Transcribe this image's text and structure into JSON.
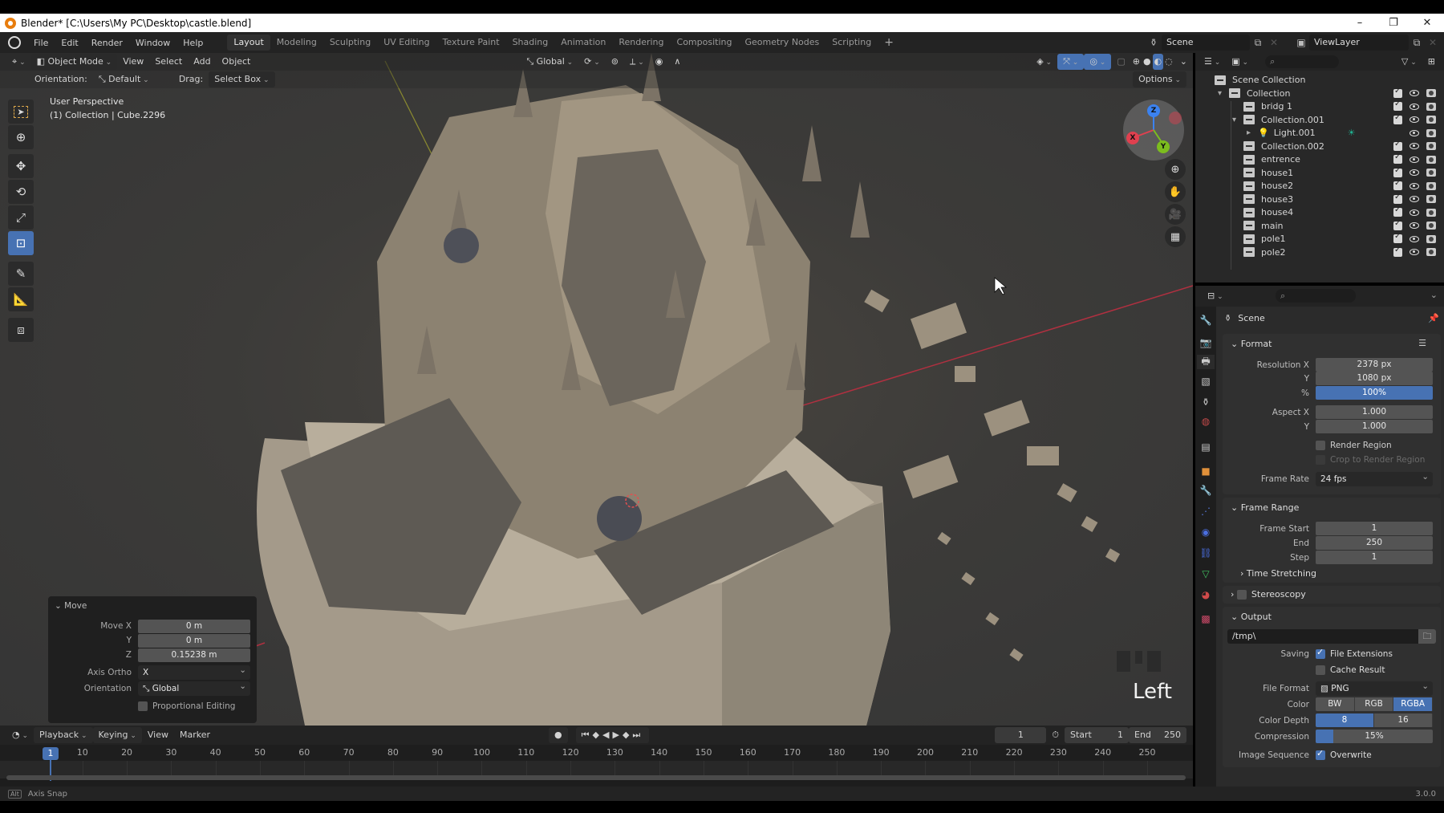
{
  "window": {
    "title": "Blender* [C:\\Users\\My PC\\Desktop\\castle.blend]",
    "controls": [
      "–",
      "❐",
      "✕"
    ]
  },
  "menubar": {
    "menus": [
      "File",
      "Edit",
      "Render",
      "Window",
      "Help"
    ],
    "workspaces": [
      "Layout",
      "Modeling",
      "Sculpting",
      "UV Editing",
      "Texture Paint",
      "Shading",
      "Animation",
      "Rendering",
      "Compositing",
      "Geometry Nodes",
      "Scripting"
    ],
    "active_workspace": "Layout",
    "add_workspace": "+",
    "scene": "Scene",
    "view_layer": "ViewLayer"
  },
  "viewport": {
    "header": {
      "mode": "Object Mode",
      "menus": [
        "View",
        "Select",
        "Add",
        "Object"
      ],
      "transform_orientation": "Global",
      "options_label": "Options"
    },
    "tool_settings": {
      "orientation_label": "Orientation:",
      "orientation_value": "Default",
      "drag_label": "Drag:",
      "drag_value": "Select Box"
    },
    "info_line1": "User Perspective",
    "info_line2": "(1) Collection | Cube.2296",
    "tools": [
      "select-box",
      "cursor",
      "move",
      "rotate",
      "scale",
      "transform",
      "annotate",
      "measure",
      "add-cube"
    ],
    "active_tool": "transform",
    "gizmo_axes": [
      "X",
      "Y",
      "Z"
    ],
    "overlay_text": "Left"
  },
  "move_panel": {
    "title": "Move",
    "rows": [
      {
        "label": "Move X",
        "value": "0 m"
      },
      {
        "label": "Y",
        "value": "0 m"
      },
      {
        "label": "Z",
        "value": "0.15238 m"
      }
    ],
    "axis_ortho_label": "Axis Ortho",
    "axis_ortho_value": "X",
    "orientation_label": "Orientation",
    "orientation_value": "Global",
    "proportional_label": "Proportional Editing",
    "proportional_checked": false
  },
  "timeline": {
    "menus": [
      "Playback",
      "Keying",
      "View",
      "Marker"
    ],
    "current_frame": "1",
    "start_label": "Start",
    "start": "1",
    "end_label": "End",
    "end": "250",
    "ticks": [
      "10",
      "20",
      "30",
      "40",
      "50",
      "60",
      "70",
      "80",
      "90",
      "100",
      "110",
      "120",
      "130",
      "140",
      "150",
      "160",
      "170",
      "180",
      "190",
      "200",
      "210",
      "220",
      "230",
      "240",
      "250"
    ],
    "playhead": "1"
  },
  "statusbar": {
    "hint_key": "Alt",
    "hint": "Axis Snap",
    "version": "3.0.0"
  },
  "outliner": {
    "root": "Scene Collection",
    "items": [
      {
        "name": "Collection",
        "depth": 0,
        "expanded": true,
        "type": "collection"
      },
      {
        "name": "bridg 1",
        "depth": 1,
        "type": "collection"
      },
      {
        "name": "Collection.001",
        "depth": 1,
        "expanded": true,
        "type": "collection"
      },
      {
        "name": "Light.001",
        "depth": 2,
        "type": "light"
      },
      {
        "name": "Collection.002",
        "depth": 1,
        "type": "collection"
      },
      {
        "name": "entrence",
        "depth": 1,
        "type": "collection"
      },
      {
        "name": "house1",
        "depth": 1,
        "type": "collection"
      },
      {
        "name": "house2",
        "depth": 1,
        "type": "collection"
      },
      {
        "name": "house3",
        "depth": 1,
        "type": "collection"
      },
      {
        "name": "house4",
        "depth": 1,
        "type": "collection"
      },
      {
        "name": "main",
        "depth": 1,
        "type": "collection"
      },
      {
        "name": "pole1",
        "depth": 1,
        "type": "collection"
      },
      {
        "name": "pole2",
        "depth": 1,
        "type": "collection"
      }
    ]
  },
  "properties": {
    "context": "Scene",
    "format": {
      "title": "Format",
      "resolution_x_label": "Resolution X",
      "resolution_x": "2378 px",
      "resolution_y_label": "Y",
      "resolution_y": "1080 px",
      "percent_label": "%",
      "percent": "100%",
      "aspect_x_label": "Aspect X",
      "aspect_x": "1.000",
      "aspect_y_label": "Y",
      "aspect_y": "1.000",
      "render_region": "Render Region",
      "crop_region": "Crop to Render Region",
      "frame_rate_label": "Frame Rate",
      "frame_rate": "24 fps"
    },
    "frame_range": {
      "title": "Frame Range",
      "start_label": "Frame Start",
      "start": "1",
      "end_label": "End",
      "end": "250",
      "step_label": "Step",
      "step": "1",
      "time_stretching": "Time Stretching"
    },
    "stereoscopy": "Stereoscopy",
    "output": {
      "title": "Output",
      "path": "/tmp\\",
      "saving_label": "Saving",
      "file_extensions": "File Extensions",
      "cache_result": "Cache Result",
      "file_format_label": "File Format",
      "file_format": "PNG",
      "color_label": "Color",
      "color_options": [
        "BW",
        "RGB",
        "RGBA"
      ],
      "color_selected": "RGBA",
      "color_depth_label": "Color Depth",
      "color_depth_options": [
        "8",
        "16"
      ],
      "color_depth_selected": "8",
      "compression_label": "Compression",
      "compression": "15%",
      "image_sequence_label": "Image Sequence",
      "overwrite": "Overwrite"
    }
  }
}
